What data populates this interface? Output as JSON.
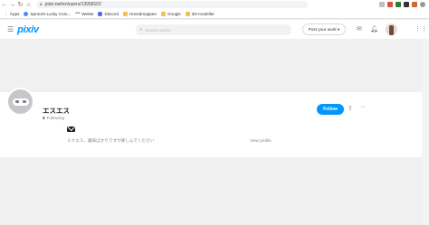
{
  "browser": {
    "nav": {
      "back": "←",
      "forward": "→",
      "reload": "↻",
      "home": "⌂"
    },
    "url": "pixiv.net/en/users/13958102"
  },
  "bookmarks": [
    {
      "label": "Apps",
      "icon": "apps-icon",
      "kind": "apps"
    },
    {
      "label": "Sprout's Lucky Com...",
      "icon": "globe-icon",
      "kind": "round"
    },
    {
      "label": "WeMe",
      "icon": "dots-icon",
      "kind": "dots"
    },
    {
      "label": "Discord",
      "icon": "discord-icon",
      "kind": "discord"
    },
    {
      "label": "Hovedmappen",
      "icon": "folder-icon",
      "kind": "folder"
    },
    {
      "label": "Google",
      "icon": "folder-icon",
      "kind": "folder"
    },
    {
      "label": "3D-modeller",
      "icon": "folder-icon",
      "kind": "folder"
    }
  ],
  "header": {
    "logo": "pixiv",
    "search_placeholder": "Search works",
    "post_label": "Post your work ▾"
  },
  "profile": {
    "username": "エスエス",
    "following_count": "3",
    "following_label": "Following",
    "follow_label": "Follow",
    "bio": "ミクエス、趣味ばかりですが楽しんでください",
    "view_profile": "View profile"
  },
  "colors": {
    "accent": "#0096fa",
    "background": "#f0f0f0"
  }
}
